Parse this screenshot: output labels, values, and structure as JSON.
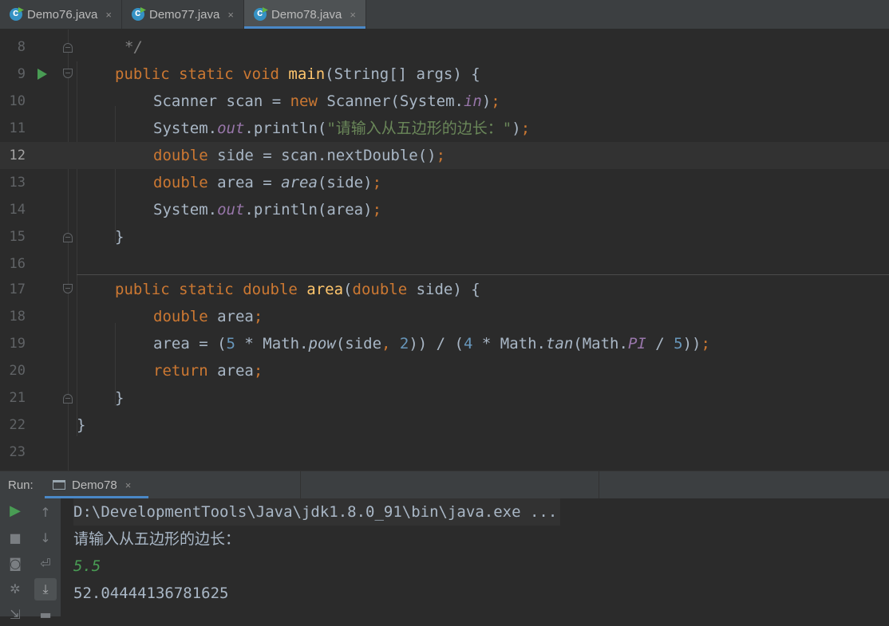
{
  "tabs": [
    {
      "label": "Demo76.java",
      "close": "×"
    },
    {
      "label": "Demo77.java",
      "close": "×"
    },
    {
      "label": "Demo78.java",
      "close": "×",
      "active": true
    }
  ],
  "editor": {
    "line_numbers": [
      "8",
      "9",
      "10",
      "11",
      "12",
      "13",
      "14",
      "15",
      "16",
      "17",
      "18",
      "19",
      "20",
      "21",
      "22",
      "23"
    ],
    "current_line": "12",
    "code": {
      "l8_comment": "*/",
      "l9": [
        "public",
        "static",
        "void",
        "main",
        "(String[] args) {"
      ],
      "l10": [
        "Scanner scan = ",
        "new",
        " Scanner(System.",
        "in",
        ")",
        ";"
      ],
      "l11": [
        "System.",
        "out",
        ".println(",
        "\"请输入从五边形的边长：\"",
        ")",
        ";"
      ],
      "l12": [
        "double",
        " side = scan.nextDouble()",
        ";"
      ],
      "l13": [
        "double",
        " area = ",
        "area",
        "(side)",
        ";"
      ],
      "l14": [
        "System.",
        "out",
        ".println(area)",
        ";"
      ],
      "l15": "}",
      "l17": [
        "public",
        "static",
        "double",
        "area",
        "(",
        "double",
        " side) {"
      ],
      "l18": [
        "double",
        " area",
        ";"
      ],
      "l19": [
        "area = (",
        "5",
        " * Math.",
        "pow",
        "(side",
        ", ",
        "2",
        ")) / (",
        "4",
        " * Math.",
        "tan",
        "(Math.",
        "PI",
        " / ",
        "5",
        "))",
        ";"
      ],
      "l20": [
        "return",
        " area",
        ";"
      ],
      "l21": "}",
      "l22": "}"
    }
  },
  "run_panel": {
    "label": "Run:",
    "tab_label": "Demo78",
    "tab_close": "×",
    "output": {
      "command": "D:\\DevelopmentTools\\Java\\jdk1.8.0_91\\bin\\java.exe ...",
      "prompt": "请输入从五边形的边长：",
      "user_input": "5.5",
      "result": "52.04444136781625"
    }
  },
  "colors": {
    "background": "#2b2b2b",
    "keyword": "#cc7832",
    "method": "#ffc66d",
    "string": "#6a8759",
    "number": "#6897bb",
    "static_field": "#9876aa",
    "run_green": "#499c54"
  }
}
